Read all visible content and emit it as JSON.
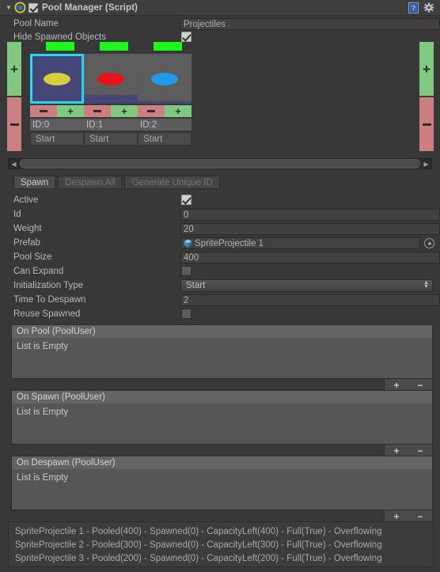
{
  "header": {
    "title": "Pool Manager (Script)",
    "enabled_checkbox": true,
    "foldout": "▼",
    "script_icon": "script-icon",
    "help_icon": "help-icon",
    "gear_icon": "gear-icon"
  },
  "top_fields": {
    "pool_name_label": "Pool Name",
    "pool_name_value": "Projectiles",
    "hide_spawned_label": "Hide Spawned Objects",
    "hide_spawned_checked": true
  },
  "pool_strip": {
    "add_pool_label": "+",
    "remove_pool_label": "—",
    "cards": [
      {
        "id_label": "ID:0",
        "init_label": "Start",
        "minus_label": "—",
        "plus_label": "+",
        "selected": true,
        "status_color": "#1cf71c",
        "ellipse_color": "#d8cc3f",
        "fill_color": "#474679",
        "fill_percent": 100
      },
      {
        "id_label": "ID:1",
        "init_label": "Start",
        "minus_label": "—",
        "plus_label": "+",
        "selected": false,
        "status_color": "#1cf71c",
        "ellipse_color": "#e81414",
        "fill_color": "#474679",
        "fill_percent": 17
      },
      {
        "id_label": "ID:2",
        "init_label": "Start",
        "minus_label": "—",
        "plus_label": "+",
        "selected": false,
        "status_color": "#1cf71c",
        "ellipse_color": "#1e9ae8",
        "fill_color": "#474679",
        "fill_percent": 5
      }
    ]
  },
  "scrollbar": {
    "left_arrow": "◀",
    "right_arrow": "▶"
  },
  "toolbar": {
    "spawn_label": "Spawn",
    "despawn_all_label": "Despawn All",
    "generate_id_label": "Generate Unique ID"
  },
  "properties": {
    "active_label": "Active",
    "active_checked": true,
    "id_label": "Id",
    "id_value": "0",
    "weight_label": "Weight",
    "weight_value": "20",
    "prefab_label": "Prefab",
    "prefab_value": "SpriteProjectile 1",
    "prefab_icon": "prefab-cube-icon",
    "pool_size_label": "Pool Size",
    "pool_size_value": "400",
    "can_expand_label": "Can Expand",
    "can_expand_checked": false,
    "init_type_label": "Initialization Type",
    "init_type_value": "Start",
    "time_to_despawn_label": "Time To Despawn",
    "time_to_despawn_value": "2",
    "reuse_spawned_label": "Reuse Spawned",
    "reuse_spawned_checked": false
  },
  "events": [
    {
      "title": "On Pool (PoolUser)",
      "empty_text": "List is Empty",
      "add_label": "+",
      "remove_label": "−"
    },
    {
      "title": "On Spawn (PoolUser)",
      "empty_text": "List is Empty",
      "add_label": "+",
      "remove_label": "−"
    },
    {
      "title": "On Despawn (PoolUser)",
      "empty_text": "List is Empty",
      "add_label": "+",
      "remove_label": "−"
    }
  ],
  "status": {
    "lines": [
      "SpriteProjectile 1 - Pooled(400) - Spawned(0) - CapacityLeft(400) - Full(True) - Overflowing",
      "SpriteProjectile 2 - Pooled(300) - Spawned(0) - CapacityLeft(300) - Full(True) - Overflowing",
      "SpriteProjectile 3 - Pooled(200) - Spawned(0) - CapacityLeft(200) - Full(True) - Overflowing"
    ]
  }
}
